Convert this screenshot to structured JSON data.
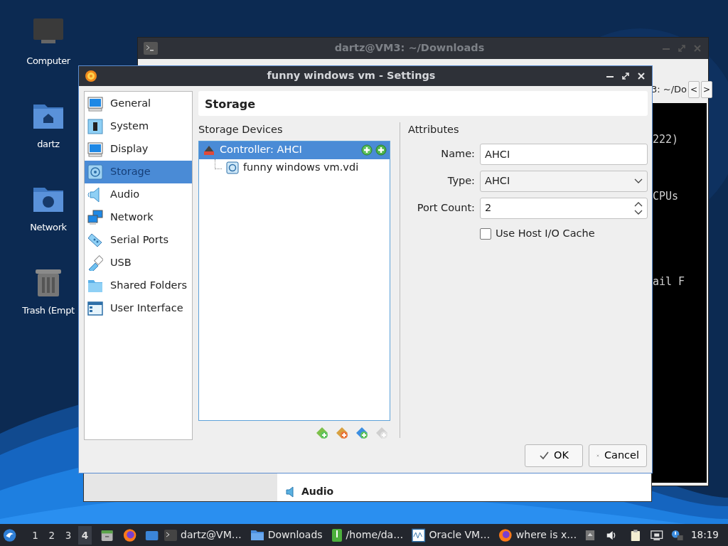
{
  "desktop_icons": [
    {
      "label": "Computer",
      "kind": "computer"
    },
    {
      "label": "dartz",
      "kind": "home"
    },
    {
      "label": "Network",
      "kind": "network"
    },
    {
      "label": "Trash (Empt",
      "kind": "trash"
    }
  ],
  "terminal_window": {
    "title": "dartz@VM3: ~/Downloads",
    "tab_label": "3: ~/Do",
    "tab_scroll": [
      "<",
      ">"
    ],
    "lines": [
      "222)",
      "CPUs",
      "ail F"
    ]
  },
  "manager_window": {
    "section": "Audio"
  },
  "settings_dialog": {
    "title": "funny windows vm - Settings",
    "sections": [
      {
        "label": "General",
        "selected": false
      },
      {
        "label": "System",
        "selected": false
      },
      {
        "label": "Display",
        "selected": false
      },
      {
        "label": "Storage",
        "selected": true
      },
      {
        "label": "Audio",
        "selected": false
      },
      {
        "label": "Network",
        "selected": false
      },
      {
        "label": "Serial Ports",
        "selected": false
      },
      {
        "label": "USB",
        "selected": false
      },
      {
        "label": "Shared Folders",
        "selected": false
      },
      {
        "label": "User Interface",
        "selected": false
      }
    ],
    "page_title": "Storage",
    "storage_devices": {
      "label": "Storage Devices",
      "tree": [
        {
          "label": "Controller: AHCI",
          "selected": true,
          "children": [
            {
              "label": "funny windows vm.vdi",
              "selected": false
            }
          ]
        }
      ],
      "tools": [
        {
          "kind": "add-controller",
          "disabled": false
        },
        {
          "kind": "remove-controller",
          "disabled": false
        },
        {
          "kind": "add-attachment",
          "disabled": false
        },
        {
          "kind": "remove-attachment",
          "disabled": true
        }
      ]
    },
    "attributes": {
      "label": "Attributes",
      "name": {
        "label": "Name:",
        "value": "AHCI"
      },
      "type": {
        "label": "Type:",
        "value": "AHCI"
      },
      "port_count": {
        "label": "Port Count:",
        "value": "2"
      },
      "host_io_cache": {
        "label": "Use Host I/O Cache",
        "checked": false
      }
    },
    "buttons": [
      {
        "label": "OK",
        "kind": "ok"
      },
      {
        "label": "Cancel",
        "kind": "cancel"
      }
    ]
  },
  "taskbar": {
    "workspaces": [
      {
        "label": "1",
        "selected": false
      },
      {
        "label": "2",
        "selected": false
      },
      {
        "label": "3",
        "selected": false
      },
      {
        "label": "4",
        "selected": true
      }
    ],
    "tasks": [
      {
        "label": "dartz@VM…",
        "kind": "terminal"
      },
      {
        "label": "Downloads",
        "kind": "folder"
      },
      {
        "label": "/home/da…",
        "kind": "archive"
      },
      {
        "label": "Oracle VM…",
        "kind": "virtualbox"
      },
      {
        "label": "where is x…",
        "kind": "browser"
      }
    ],
    "clock": "18:19"
  }
}
